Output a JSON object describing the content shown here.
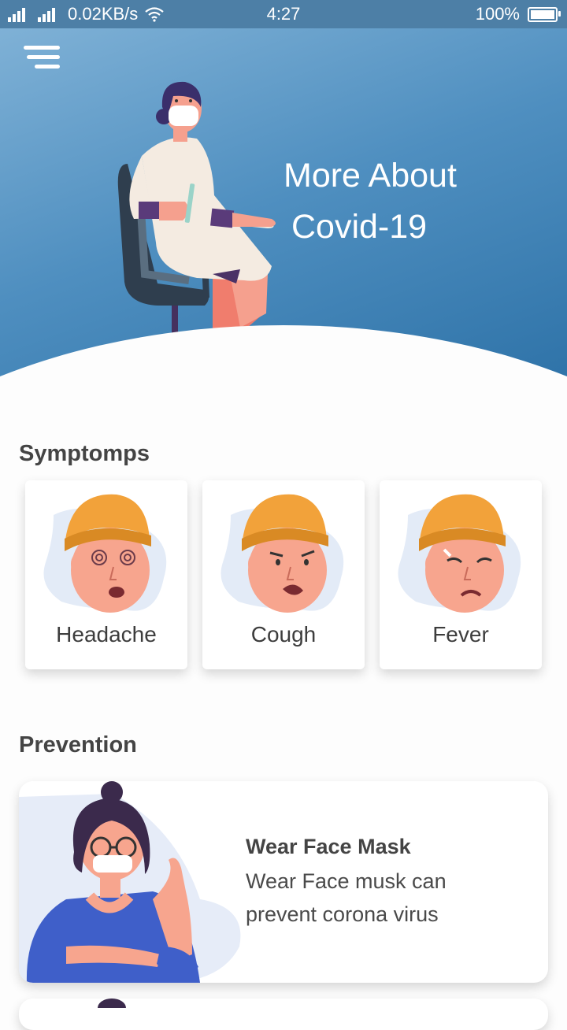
{
  "status_bar": {
    "network_speed": "0.02KB/s",
    "time": "4:27",
    "battery": "100%"
  },
  "hero": {
    "title_line1": "More About",
    "title_line2": "Covid-19"
  },
  "symptoms": {
    "title": "Symptomps",
    "items": [
      {
        "label": "Headache"
      },
      {
        "label": "Cough"
      },
      {
        "label": "Fever"
      }
    ]
  },
  "prevention": {
    "title": "Prevention",
    "items": [
      {
        "title": "Wear Face Mask",
        "description": "Wear Face musk can prevent corona virus"
      }
    ]
  },
  "colors": {
    "hero_start": "#7fb1d6",
    "hero_end": "#2a6fa5",
    "beanie": "#f2a23a",
    "skin": "#f7a58e",
    "shirt": "#3f5fc9"
  }
}
